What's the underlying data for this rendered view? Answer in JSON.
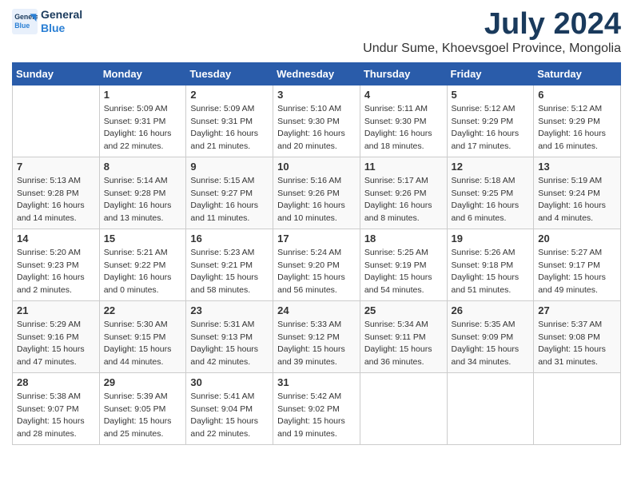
{
  "header": {
    "logo_line1": "General",
    "logo_line2": "Blue",
    "month": "July 2024",
    "location": "Undur Sume, Khoevsgoel Province, Mongolia"
  },
  "days_of_week": [
    "Sunday",
    "Monday",
    "Tuesday",
    "Wednesday",
    "Thursday",
    "Friday",
    "Saturday"
  ],
  "weeks": [
    [
      {
        "day": "",
        "sunrise": "",
        "sunset": "",
        "daylight": ""
      },
      {
        "day": "1",
        "sunrise": "5:09 AM",
        "sunset": "9:31 PM",
        "daylight": "16 hours and 22 minutes."
      },
      {
        "day": "2",
        "sunrise": "5:09 AM",
        "sunset": "9:31 PM",
        "daylight": "16 hours and 21 minutes."
      },
      {
        "day": "3",
        "sunrise": "5:10 AM",
        "sunset": "9:30 PM",
        "daylight": "16 hours and 20 minutes."
      },
      {
        "day": "4",
        "sunrise": "5:11 AM",
        "sunset": "9:30 PM",
        "daylight": "16 hours and 18 minutes."
      },
      {
        "day": "5",
        "sunrise": "5:12 AM",
        "sunset": "9:29 PM",
        "daylight": "16 hours and 17 minutes."
      },
      {
        "day": "6",
        "sunrise": "5:12 AM",
        "sunset": "9:29 PM",
        "daylight": "16 hours and 16 minutes."
      }
    ],
    [
      {
        "day": "7",
        "sunrise": "5:13 AM",
        "sunset": "9:28 PM",
        "daylight": "16 hours and 14 minutes."
      },
      {
        "day": "8",
        "sunrise": "5:14 AM",
        "sunset": "9:28 PM",
        "daylight": "16 hours and 13 minutes."
      },
      {
        "day": "9",
        "sunrise": "5:15 AM",
        "sunset": "9:27 PM",
        "daylight": "16 hours and 11 minutes."
      },
      {
        "day": "10",
        "sunrise": "5:16 AM",
        "sunset": "9:26 PM",
        "daylight": "16 hours and 10 minutes."
      },
      {
        "day": "11",
        "sunrise": "5:17 AM",
        "sunset": "9:26 PM",
        "daylight": "16 hours and 8 minutes."
      },
      {
        "day": "12",
        "sunrise": "5:18 AM",
        "sunset": "9:25 PM",
        "daylight": "16 hours and 6 minutes."
      },
      {
        "day": "13",
        "sunrise": "5:19 AM",
        "sunset": "9:24 PM",
        "daylight": "16 hours and 4 minutes."
      }
    ],
    [
      {
        "day": "14",
        "sunrise": "5:20 AM",
        "sunset": "9:23 PM",
        "daylight": "16 hours and 2 minutes."
      },
      {
        "day": "15",
        "sunrise": "5:21 AM",
        "sunset": "9:22 PM",
        "daylight": "16 hours and 0 minutes."
      },
      {
        "day": "16",
        "sunrise": "5:23 AM",
        "sunset": "9:21 PM",
        "daylight": "15 hours and 58 minutes."
      },
      {
        "day": "17",
        "sunrise": "5:24 AM",
        "sunset": "9:20 PM",
        "daylight": "15 hours and 56 minutes."
      },
      {
        "day": "18",
        "sunrise": "5:25 AM",
        "sunset": "9:19 PM",
        "daylight": "15 hours and 54 minutes."
      },
      {
        "day": "19",
        "sunrise": "5:26 AM",
        "sunset": "9:18 PM",
        "daylight": "15 hours and 51 minutes."
      },
      {
        "day": "20",
        "sunrise": "5:27 AM",
        "sunset": "9:17 PM",
        "daylight": "15 hours and 49 minutes."
      }
    ],
    [
      {
        "day": "21",
        "sunrise": "5:29 AM",
        "sunset": "9:16 PM",
        "daylight": "15 hours and 47 minutes."
      },
      {
        "day": "22",
        "sunrise": "5:30 AM",
        "sunset": "9:15 PM",
        "daylight": "15 hours and 44 minutes."
      },
      {
        "day": "23",
        "sunrise": "5:31 AM",
        "sunset": "9:13 PM",
        "daylight": "15 hours and 42 minutes."
      },
      {
        "day": "24",
        "sunrise": "5:33 AM",
        "sunset": "9:12 PM",
        "daylight": "15 hours and 39 minutes."
      },
      {
        "day": "25",
        "sunrise": "5:34 AM",
        "sunset": "9:11 PM",
        "daylight": "15 hours and 36 minutes."
      },
      {
        "day": "26",
        "sunrise": "5:35 AM",
        "sunset": "9:09 PM",
        "daylight": "15 hours and 34 minutes."
      },
      {
        "day": "27",
        "sunrise": "5:37 AM",
        "sunset": "9:08 PM",
        "daylight": "15 hours and 31 minutes."
      }
    ],
    [
      {
        "day": "28",
        "sunrise": "5:38 AM",
        "sunset": "9:07 PM",
        "daylight": "15 hours and 28 minutes."
      },
      {
        "day": "29",
        "sunrise": "5:39 AM",
        "sunset": "9:05 PM",
        "daylight": "15 hours and 25 minutes."
      },
      {
        "day": "30",
        "sunrise": "5:41 AM",
        "sunset": "9:04 PM",
        "daylight": "15 hours and 22 minutes."
      },
      {
        "day": "31",
        "sunrise": "5:42 AM",
        "sunset": "9:02 PM",
        "daylight": "15 hours and 19 minutes."
      },
      {
        "day": "",
        "sunrise": "",
        "sunset": "",
        "daylight": ""
      },
      {
        "day": "",
        "sunrise": "",
        "sunset": "",
        "daylight": ""
      },
      {
        "day": "",
        "sunrise": "",
        "sunset": "",
        "daylight": ""
      }
    ]
  ]
}
